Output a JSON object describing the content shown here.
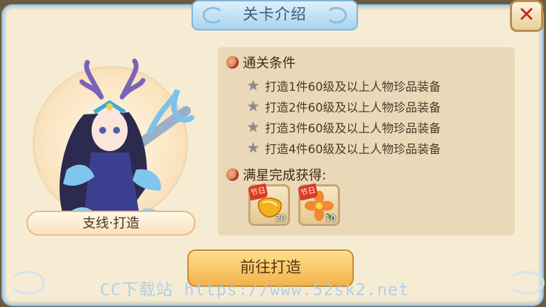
{
  "dialog": {
    "title": "关卡介绍",
    "close_icon": "close-x-icon"
  },
  "stage": {
    "name": "支线·打造"
  },
  "conditions": {
    "heading": "通关条件",
    "items": [
      "打造1件60级及以上人物珍品装备",
      "打造2件60级及以上人物珍品装备",
      "打造3件60级及以上人物珍品装备",
      "打造4件60级及以上人物珍品装备"
    ]
  },
  "rewards": {
    "heading": "满星完成获得:",
    "items": [
      {
        "tag": "节日",
        "count": "20",
        "icon": "golden-fruit-icon"
      },
      {
        "tag": "节日",
        "count": "10",
        "icon": "orange-flower-icon"
      }
    ]
  },
  "action": {
    "go_label": "前往打造"
  },
  "watermark": "CC下载站 https://www.52sk2.net",
  "colors": {
    "title_blue": "#a9d3ef",
    "panel": "#ead9b9",
    "button_gold": "#f2b24a",
    "close_red": "#c9241e"
  }
}
